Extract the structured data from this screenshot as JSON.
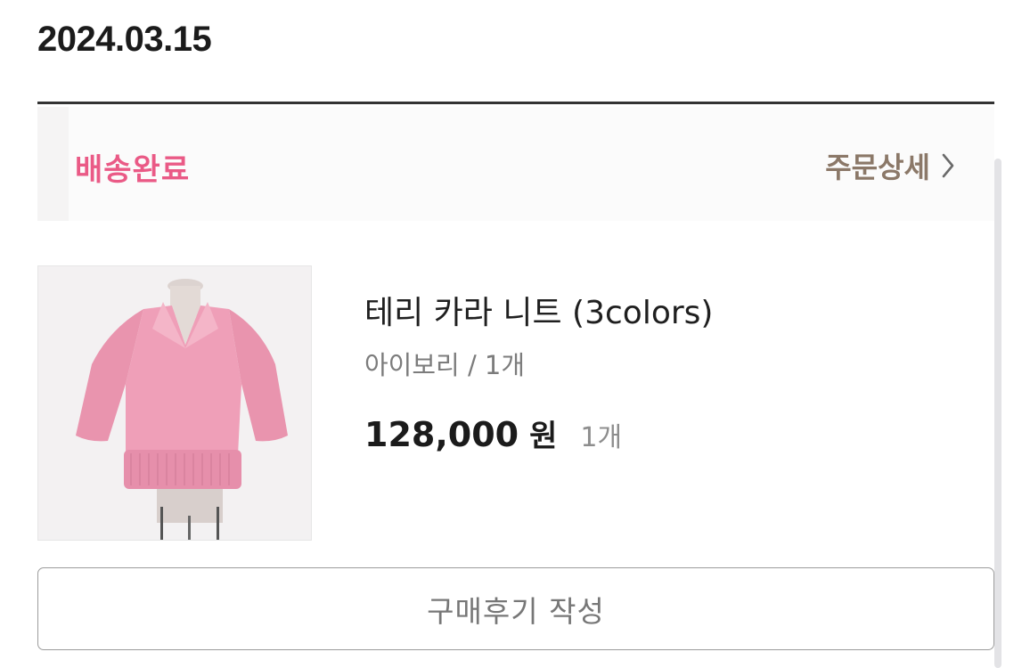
{
  "order": {
    "date": "2024.03.15",
    "status": "배송완료",
    "detail_link": "주문상세",
    "status_color": "#ea5a86",
    "detail_color": "#8b7868"
  },
  "product": {
    "name": "테리 카라 니트 (3colors)",
    "option": "아이보리 / 1개",
    "price": "128,000",
    "currency": "원",
    "quantity": "1개",
    "image_desc_icon": "pink-knit-sweater-image"
  },
  "actions": {
    "review_button": "구매후기 작성"
  }
}
